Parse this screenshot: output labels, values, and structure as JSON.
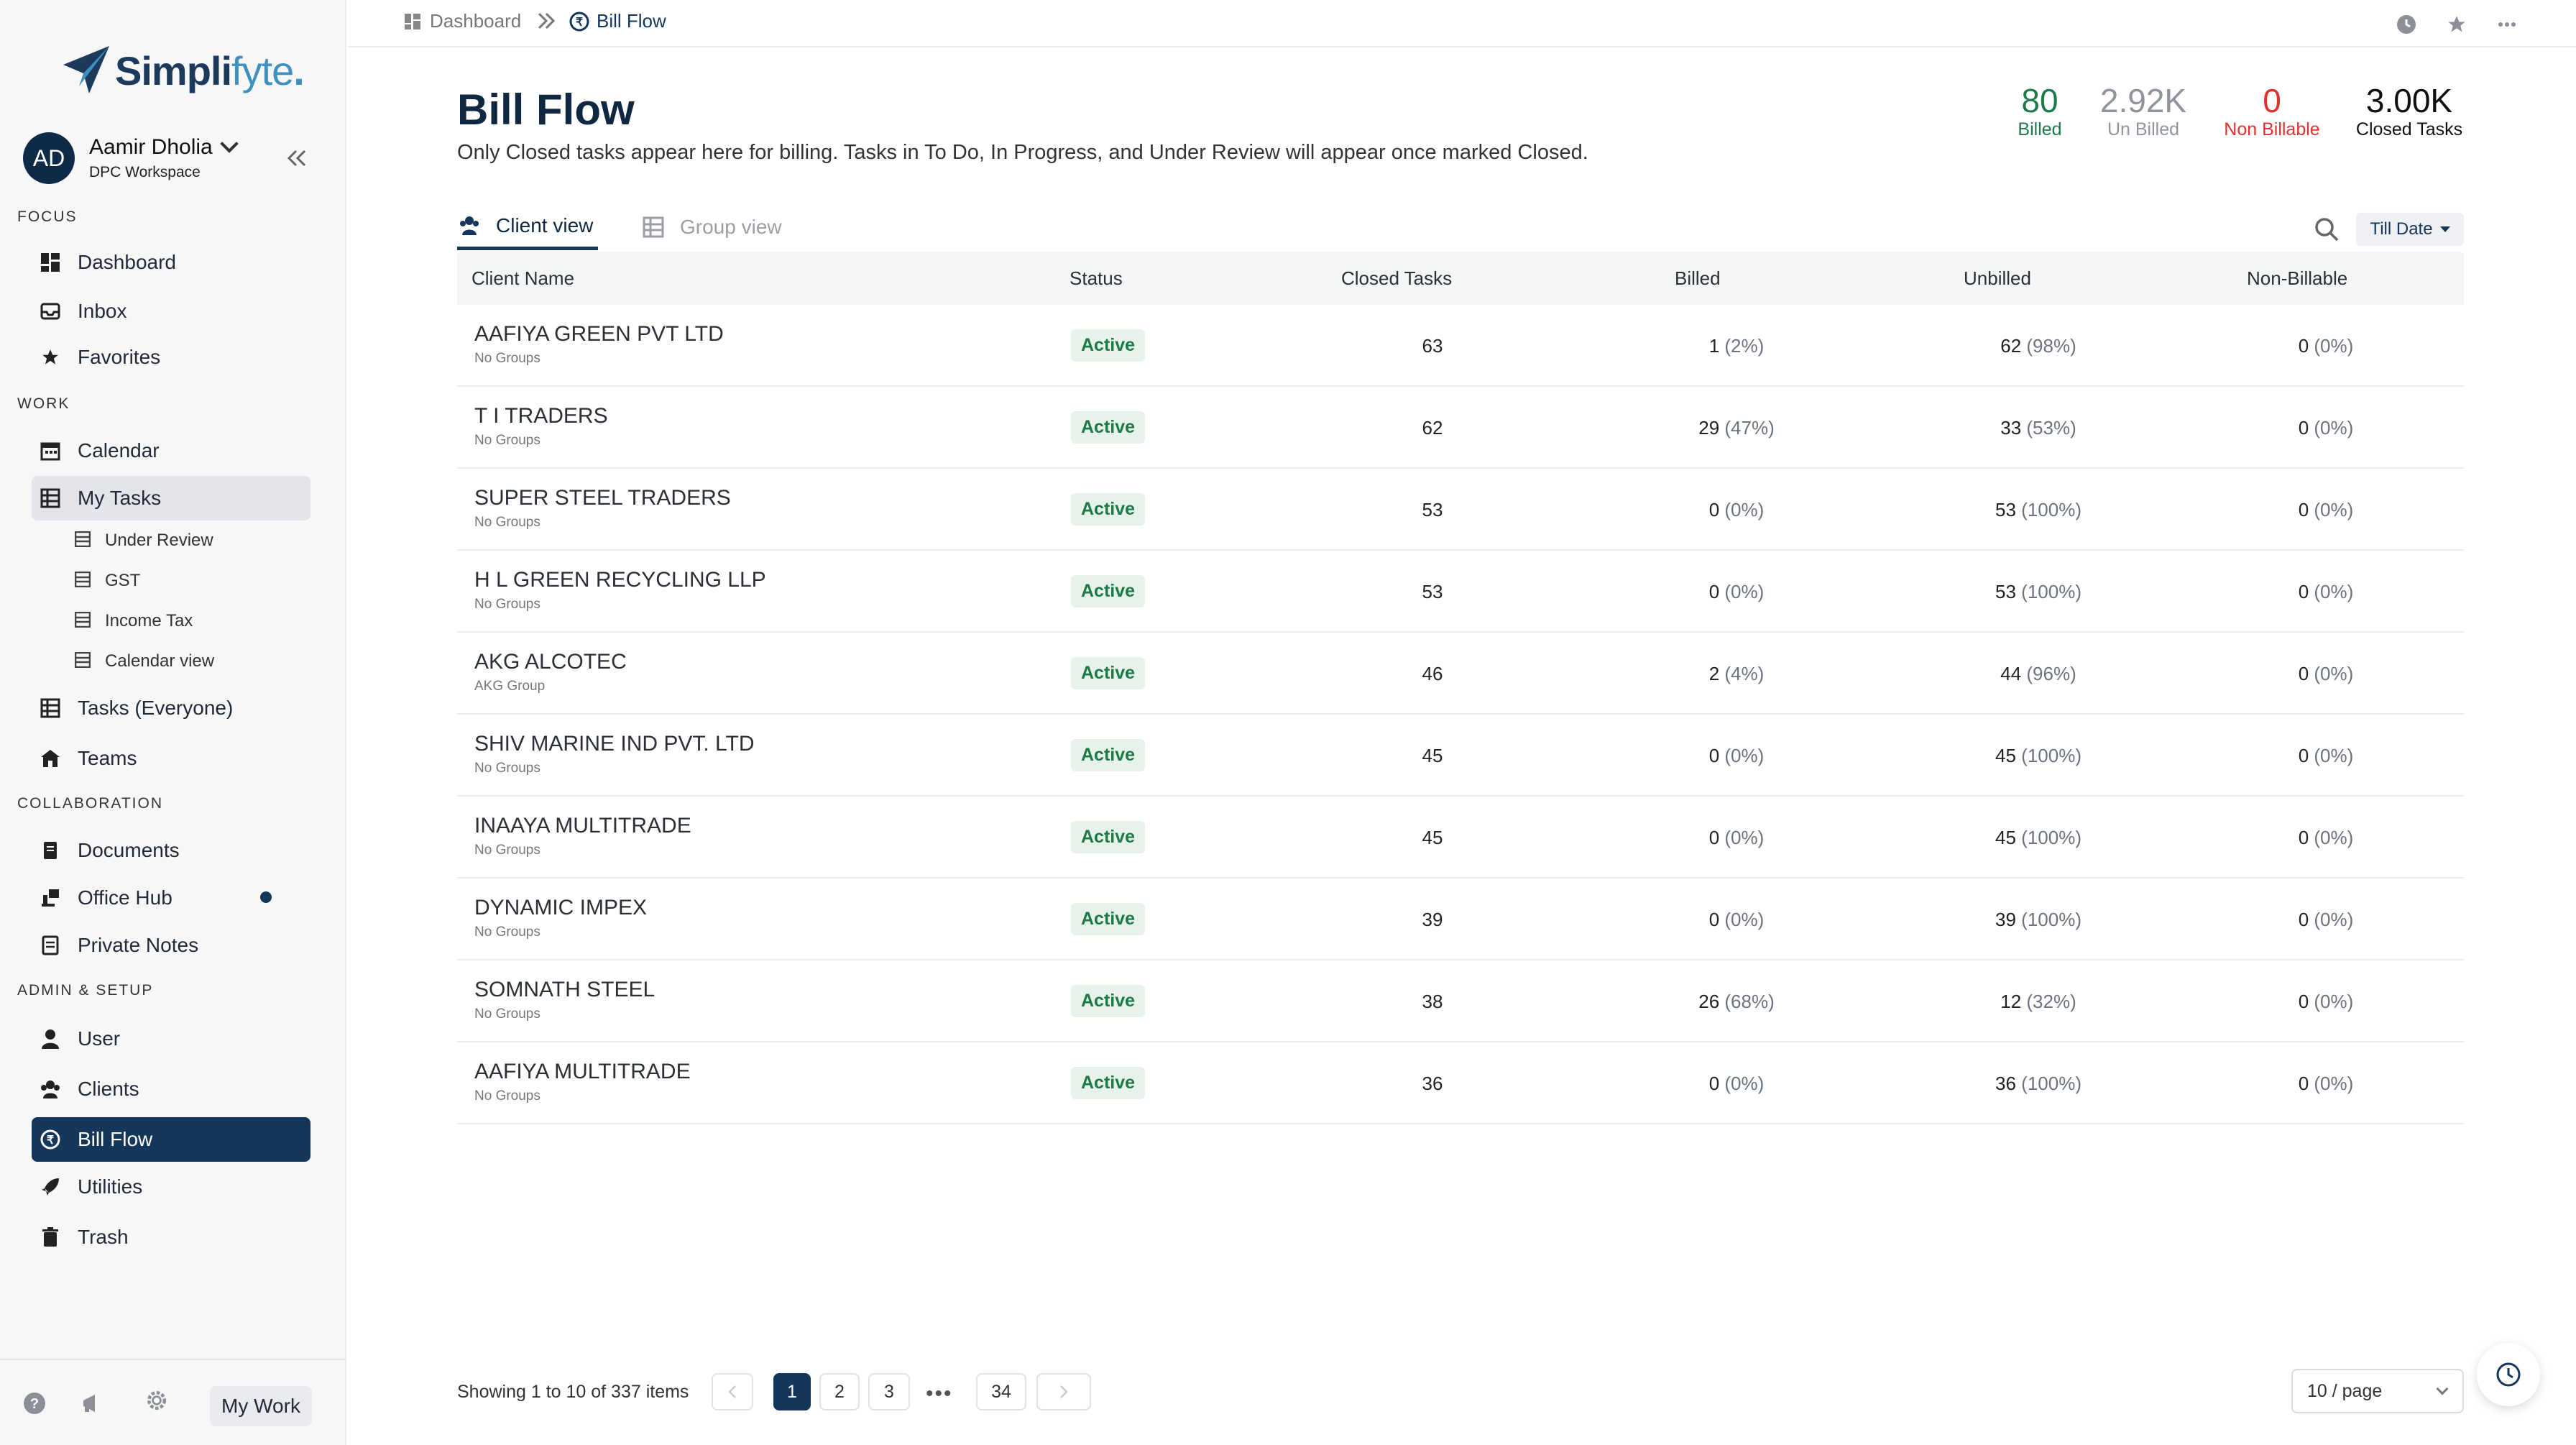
{
  "colors": {
    "navy": "#14365a",
    "active_green": "#1c7a47",
    "billed_green": "#1f7a4a",
    "non_billable_red": "#e03131"
  },
  "brand": {
    "name_bold": "Simpli",
    "name_light": "fyte",
    "dot": "."
  },
  "profile": {
    "initials": "AD",
    "name": "Aamir Dholia",
    "workspace": "DPC Workspace"
  },
  "sidebar": {
    "sections": {
      "focus": "FOCUS",
      "work": "WORK",
      "collab": "COLLABORATION",
      "admin": "ADMIN & SETUP"
    },
    "items": {
      "dashboard": "Dashboard",
      "inbox": "Inbox",
      "favorites": "Favorites",
      "calendar": "Calendar",
      "my_tasks": "My Tasks",
      "under_review": "Under Review",
      "gst": "GST",
      "income_tax": "Income Tax",
      "calendar_view": "Calendar view",
      "tasks_everyone": "Tasks (Everyone)",
      "teams": "Teams",
      "documents": "Documents",
      "office_hub": "Office Hub",
      "private_notes": "Private Notes",
      "user": "User",
      "clients": "Clients",
      "bill_flow": "Bill Flow",
      "utilities": "Utilities",
      "trash": "Trash"
    },
    "footer_button": "My Work"
  },
  "breadcrumb": {
    "parent": "Dashboard",
    "current": "Bill Flow"
  },
  "page": {
    "title": "Bill Flow",
    "subtitle": "Only Closed tasks appear here for billing. Tasks in To Do, In Progress, and Under Review will appear once marked Closed."
  },
  "stats": [
    {
      "value": "80",
      "label": "Billed"
    },
    {
      "value": "2.92K",
      "label": "Un Billed"
    },
    {
      "value": "0",
      "label": "Non Billable"
    },
    {
      "value": "3.00K",
      "label": "Closed Tasks"
    }
  ],
  "tabs": {
    "client_view": "Client view",
    "group_view": "Group view"
  },
  "filter": {
    "till_date": "Till Date"
  },
  "table": {
    "headers": [
      "Client Name",
      "Status",
      "Closed Tasks",
      "Billed",
      "Unbilled",
      "Non-Billable"
    ],
    "rows": [
      {
        "name": "AAFIYA GREEN PVT LTD",
        "group": "No Groups",
        "status": "Active",
        "closed": "63",
        "billed": "1",
        "billed_pct": "(2%)",
        "unbilled": "62",
        "unbilled_pct": "(98%)",
        "non": "0",
        "non_pct": "(0%)"
      },
      {
        "name": "T I TRADERS",
        "group": "No Groups",
        "status": "Active",
        "closed": "62",
        "billed": "29",
        "billed_pct": "(47%)",
        "unbilled": "33",
        "unbilled_pct": "(53%)",
        "non": "0",
        "non_pct": "(0%)"
      },
      {
        "name": "SUPER STEEL TRADERS",
        "group": "No Groups",
        "status": "Active",
        "closed": "53",
        "billed": "0",
        "billed_pct": "(0%)",
        "unbilled": "53",
        "unbilled_pct": "(100%)",
        "non": "0",
        "non_pct": "(0%)"
      },
      {
        "name": "H L GREEN RECYCLING LLP",
        "group": "No Groups",
        "status": "Active",
        "closed": "53",
        "billed": "0",
        "billed_pct": "(0%)",
        "unbilled": "53",
        "unbilled_pct": "(100%)",
        "non": "0",
        "non_pct": "(0%)"
      },
      {
        "name": "AKG ALCOTEC",
        "group": "AKG Group",
        "status": "Active",
        "closed": "46",
        "billed": "2",
        "billed_pct": "(4%)",
        "unbilled": "44",
        "unbilled_pct": "(96%)",
        "non": "0",
        "non_pct": "(0%)"
      },
      {
        "name": "SHIV MARINE IND PVT. LTD",
        "group": "No Groups",
        "status": "Active",
        "closed": "45",
        "billed": "0",
        "billed_pct": "(0%)",
        "unbilled": "45",
        "unbilled_pct": "(100%)",
        "non": "0",
        "non_pct": "(0%)"
      },
      {
        "name": "INAAYA MULTITRADE",
        "group": "No Groups",
        "status": "Active",
        "closed": "45",
        "billed": "0",
        "billed_pct": "(0%)",
        "unbilled": "45",
        "unbilled_pct": "(100%)",
        "non": "0",
        "non_pct": "(0%)"
      },
      {
        "name": "DYNAMIC IMPEX",
        "group": "No Groups",
        "status": "Active",
        "closed": "39",
        "billed": "0",
        "billed_pct": "(0%)",
        "unbilled": "39",
        "unbilled_pct": "(100%)",
        "non": "0",
        "non_pct": "(0%)"
      },
      {
        "name": "SOMNATH STEEL",
        "group": "No Groups",
        "status": "Active",
        "closed": "38",
        "billed": "26",
        "billed_pct": "(68%)",
        "unbilled": "12",
        "unbilled_pct": "(32%)",
        "non": "0",
        "non_pct": "(0%)"
      },
      {
        "name": "AAFIYA MULTITRADE",
        "group": "No Groups",
        "status": "Active",
        "closed": "36",
        "billed": "0",
        "billed_pct": "(0%)",
        "unbilled": "36",
        "unbilled_pct": "(100%)",
        "non": "0",
        "non_pct": "(0%)"
      }
    ]
  },
  "pagination": {
    "showing": "Showing 1 to 10 of 337 items",
    "pages": [
      "1",
      "2",
      "3"
    ],
    "last_page": "34",
    "dots": "•••",
    "per_page": "10 / page"
  }
}
